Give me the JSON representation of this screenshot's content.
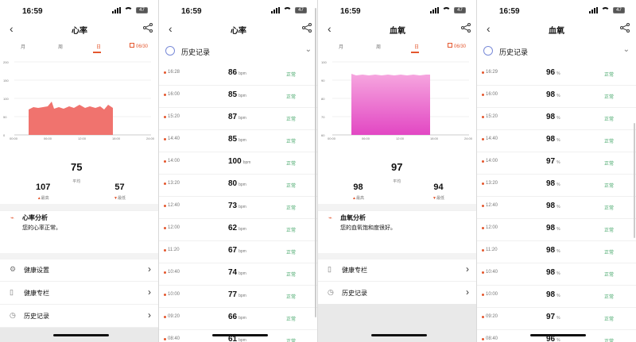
{
  "status_time": "16:59",
  "battery": "47",
  "panels": {
    "hr_title": "心率",
    "spo2_title": "血氧",
    "tabs": [
      "月",
      "周",
      "日"
    ],
    "date": "06/30",
    "hr_axis_y": [
      "200",
      "150",
      "100",
      "50",
      "0"
    ],
    "hr_axis_x": [
      "00:00",
      "06:00",
      "12:00",
      "18:00",
      "24:00"
    ],
    "spo2_axis_y": [
      "100",
      "90",
      "80",
      "70",
      "60"
    ],
    "spo2_axis_x": [
      "00:00",
      "06:00",
      "12:00",
      "18:00",
      "24:00"
    ],
    "hr_avg": "75",
    "avg_label": "平均",
    "hr_max": "107",
    "max_label": "最高",
    "hr_min": "57",
    "min_label": "最低",
    "spo2_avg": "97",
    "spo2_max": "98",
    "spo2_min": "94",
    "hr_analysis_title": "心率分析",
    "hr_analysis_text": "您的心率正常。",
    "spo2_analysis_title": "血氧分析",
    "spo2_analysis_text": "您的血氧饱和度很好。",
    "menu_settings": "健康设置",
    "menu_column": "健康专栏",
    "menu_history": "历史记录",
    "history_label": "历史记录",
    "status_normal": "正常"
  },
  "hr_history": [
    {
      "time": "16:28",
      "value": "86",
      "unit": "bpm"
    },
    {
      "time": "16:00",
      "value": "85",
      "unit": "bpm"
    },
    {
      "time": "15:20",
      "value": "87",
      "unit": "bpm"
    },
    {
      "time": "14:40",
      "value": "85",
      "unit": "bpm"
    },
    {
      "time": "14:00",
      "value": "100",
      "unit": "bpm"
    },
    {
      "time": "13:20",
      "value": "80",
      "unit": "bpm"
    },
    {
      "time": "12:40",
      "value": "73",
      "unit": "bpm"
    },
    {
      "time": "12:00",
      "value": "62",
      "unit": "bpm"
    },
    {
      "time": "11:20",
      "value": "67",
      "unit": "bpm"
    },
    {
      "time": "10:40",
      "value": "74",
      "unit": "bpm"
    },
    {
      "time": "10:00",
      "value": "77",
      "unit": "bpm"
    },
    {
      "time": "09:20",
      "value": "66",
      "unit": "bpm"
    },
    {
      "time": "08:40",
      "value": "61",
      "unit": "bpm"
    }
  ],
  "spo2_history": [
    {
      "time": "16:29",
      "value": "96",
      "unit": "%"
    },
    {
      "time": "16:00",
      "value": "98",
      "unit": "%"
    },
    {
      "time": "15:20",
      "value": "98",
      "unit": "%"
    },
    {
      "time": "14:40",
      "value": "98",
      "unit": "%"
    },
    {
      "time": "14:00",
      "value": "97",
      "unit": "%"
    },
    {
      "time": "13:20",
      "value": "98",
      "unit": "%"
    },
    {
      "time": "12:40",
      "value": "98",
      "unit": "%"
    },
    {
      "time": "12:00",
      "value": "98",
      "unit": "%"
    },
    {
      "time": "11:20",
      "value": "98",
      "unit": "%"
    },
    {
      "time": "10:40",
      "value": "98",
      "unit": "%"
    },
    {
      "time": "10:00",
      "value": "98",
      "unit": "%"
    },
    {
      "time": "09:20",
      "value": "97",
      "unit": "%"
    },
    {
      "time": "08:40",
      "value": "96",
      "unit": "%"
    }
  ],
  "colors": {
    "accent": "#e4572e",
    "hr_fill": "#ef6b66",
    "spo2_fill": "#ec5ac7",
    "normal": "#47a86b"
  }
}
